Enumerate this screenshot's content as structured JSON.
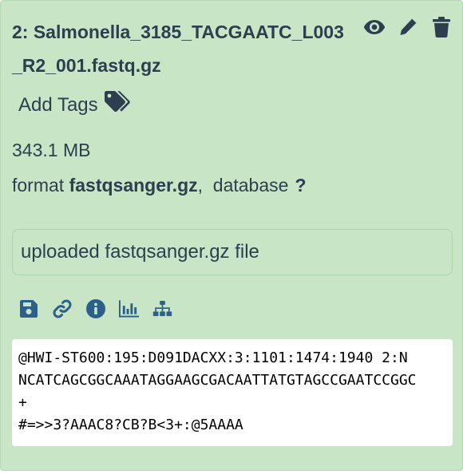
{
  "dataset": {
    "title": "2: Salmonella_3185_TACGAATC_L003_R2_001.fastq.gz",
    "add_tags_label": "Add Tags",
    "size": "343.1 MB",
    "format_label": "format",
    "format_value": "fastqsanger.gz",
    "database_label": "database",
    "database_value": "?",
    "info": "uploaded fastqsanger.gz file"
  },
  "title_actions": {
    "icons": [
      "eye-icon",
      "pencil-icon",
      "trash-icon"
    ]
  },
  "dataset_actions": {
    "icons": [
      "save-icon",
      "link-icon",
      "info-icon",
      "chart-icon",
      "sitemap-icon"
    ]
  },
  "peek": {
    "lines": [
      "@HWI-ST600:195:D091DACXX:3:1101:1474:1940 2:N",
      "NCATCAGCGGCAAATAGGAAGCGACAATTATGTAGCCGAATCCGGC",
      "+",
      "#=>>3?AAAC8?CB?B<3+:@5AAAA"
    ]
  },
  "colors": {
    "card_background": "#c8e6c6",
    "text": "#2c3e50",
    "action_icons": "#2c5f8a"
  }
}
